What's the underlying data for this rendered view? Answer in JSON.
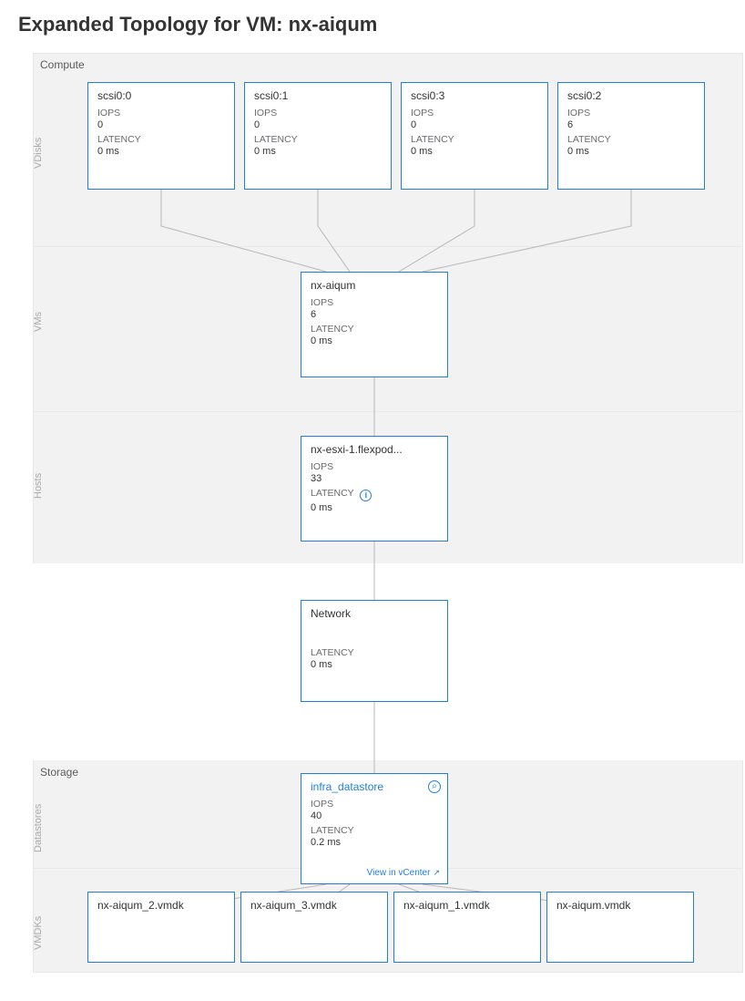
{
  "title": "Expanded Topology for VM: nx-aiqum",
  "sections": {
    "compute": "Compute",
    "storage": "Storage"
  },
  "rowLabels": {
    "vdisks": "VDisks",
    "vms": "VMs",
    "hosts": "Hosts",
    "datastores": "Datastores",
    "vmdks": "VMDKs"
  },
  "labels": {
    "iops": "IOPS",
    "latency": "LATENCY",
    "viewInVcenter": "View in vCenter"
  },
  "vdisks": [
    {
      "name": "scsi0:0",
      "iops": "0",
      "latency": "0 ms"
    },
    {
      "name": "scsi0:1",
      "iops": "0",
      "latency": "0 ms"
    },
    {
      "name": "scsi0:3",
      "iops": "0",
      "latency": "0 ms"
    },
    {
      "name": "scsi0:2",
      "iops": "6",
      "latency": "0 ms"
    }
  ],
  "vm": {
    "name": "nx-aiqum",
    "iops": "6",
    "latency": "0 ms"
  },
  "host": {
    "name": "nx-esxi-1.flexpod...",
    "iops": "33",
    "latency": "0 ms"
  },
  "network": {
    "name": "Network",
    "latency": "0 ms"
  },
  "datastore": {
    "name": "infra_datastore",
    "iops": "40",
    "latency": "0.2 ms"
  },
  "vmdks": [
    {
      "name": "nx-aiqum_2.vmdk"
    },
    {
      "name": "nx-aiqum_3.vmdk"
    },
    {
      "name": "nx-aiqum_1.vmdk"
    },
    {
      "name": "nx-aiqum.vmdk"
    }
  ]
}
